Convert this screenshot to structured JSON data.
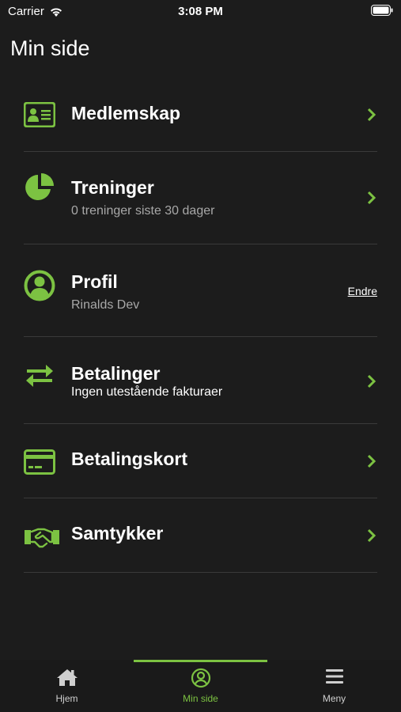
{
  "colors": {
    "accent": "#7cc242",
    "background": "#1c1c1c",
    "subtitle": "#a8a8a8",
    "tab_inactive": "#cfcfcf"
  },
  "status_bar": {
    "carrier": "Carrier",
    "time": "3:08 PM"
  },
  "page": {
    "title": "Min side"
  },
  "menu": {
    "items": [
      {
        "icon": "membership-card-icon",
        "title": "Medlemskap"
      },
      {
        "icon": "pie-chart-icon",
        "title": "Treninger",
        "subtitle": "0 treninger siste 30 dager"
      },
      {
        "icon": "user-circle-icon",
        "title": "Profil",
        "subtitle": "Rinalds Dev",
        "action": "Endre"
      },
      {
        "icon": "transfer-arrows-icon",
        "title": "Betalinger",
        "subtitle": "Ingen utestående fakturaer"
      },
      {
        "icon": "credit-card-icon",
        "title": "Betalingskort"
      },
      {
        "icon": "handshake-icon",
        "title": "Samtykker"
      }
    ]
  },
  "tabs": [
    {
      "label": "Hjem",
      "icon": "home-icon"
    },
    {
      "label": "Min side",
      "icon": "user-circle-icon",
      "active": true
    },
    {
      "label": "Meny",
      "icon": "hamburger-menu-icon"
    }
  ]
}
